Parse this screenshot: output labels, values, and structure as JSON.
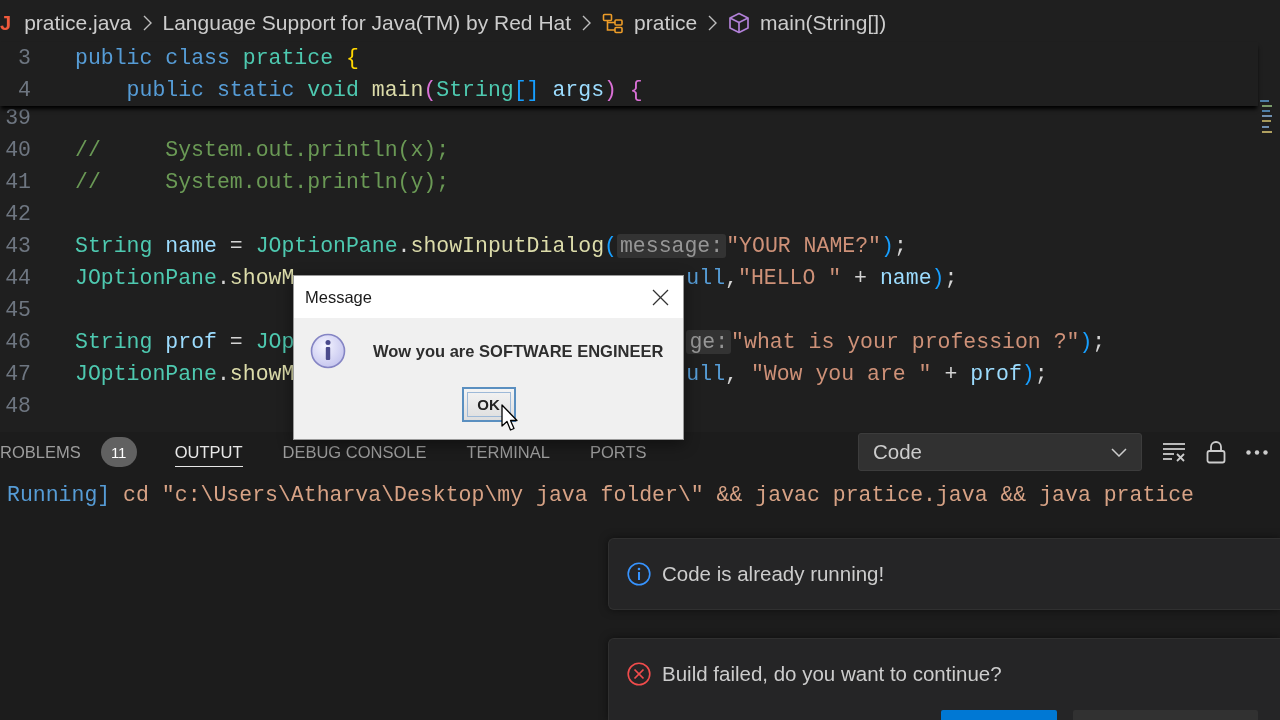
{
  "editor": {
    "breadcrumb": {
      "items": [
        {
          "label": "pratice.java",
          "kind": "file",
          "icon": "J"
        },
        {
          "label": "Language Support for Java(TM) by Red Hat",
          "kind": "module"
        },
        {
          "label": "pratice",
          "kind": "class"
        },
        {
          "label": "main(String[])",
          "kind": "method"
        }
      ]
    },
    "sticky_lines": [
      {
        "number": "3",
        "tokens": [
          {
            "text": "public",
            "kind": "keyword"
          },
          {
            "text": " class",
            "kind": "keyword"
          },
          {
            "text": " pratice",
            "kind": "type"
          },
          {
            "text": " {",
            "kind": "bracket1"
          }
        ]
      },
      {
        "number": "4",
        "tokens": [
          {
            "text": "    public",
            "kind": "keyword"
          },
          {
            "text": " static",
            "kind": "keyword"
          },
          {
            "text": " void",
            "kind": "type"
          },
          {
            "text": " main",
            "kind": "function"
          },
          {
            "text": "(",
            "kind": "bracket2"
          },
          {
            "text": "String",
            "kind": "type"
          },
          {
            "text": "[]",
            "kind": "bracket3"
          },
          {
            "text": " args",
            "kind": "variable"
          },
          {
            "text": ")",
            "kind": "bracket2"
          },
          {
            "text": " {",
            "kind": "bracket2"
          }
        ]
      }
    ],
    "lines": [
      {
        "number": "39"
      },
      {
        "number": "40",
        "tokens": [
          {
            "text": "//     System.out.println(x);",
            "kind": "comment"
          }
        ]
      },
      {
        "number": "41",
        "tokens": [
          {
            "text": "//     System.out.println(y);",
            "kind": "comment"
          }
        ]
      },
      {
        "number": "42"
      },
      {
        "number": "43",
        "tokens": [
          {
            "text": "String",
            "kind": "type"
          },
          {
            "text": " name",
            "kind": "variable"
          },
          {
            "text": " = ",
            "kind": "plain"
          },
          {
            "text": "JOptionPane",
            "kind": "type"
          },
          {
            "text": ".",
            "kind": "plain"
          },
          {
            "text": "showInputDialog",
            "kind": "function"
          },
          {
            "text": "(",
            "kind": "bracket3"
          },
          {
            "text": "message:",
            "kind": "hint"
          },
          {
            "text": "\"YOUR NAME?\"",
            "kind": "string"
          },
          {
            "text": ")",
            "kind": "bracket3"
          },
          {
            "text": ";",
            "kind": "plain"
          }
        ]
      },
      {
        "number": "44",
        "tokens": [
          {
            "text": "JOptionPane",
            "kind": "type"
          },
          {
            "text": ".",
            "kind": "plain"
          },
          {
            "text": "showM",
            "kind": "function"
          }
        ],
        "tokens_right": [
          {
            "text": "ull",
            "kind": "keyword"
          },
          {
            "text": ",",
            "kind": "plain"
          },
          {
            "text": "\"HELLO \"",
            "kind": "string"
          },
          {
            "text": " + ",
            "kind": "plain"
          },
          {
            "text": "name",
            "kind": "variable"
          },
          {
            "text": ")",
            "kind": "bracket3"
          },
          {
            "text": ";",
            "kind": "plain"
          }
        ]
      },
      {
        "number": "45"
      },
      {
        "number": "46",
        "tokens": [
          {
            "text": "String",
            "kind": "type"
          },
          {
            "text": " prof",
            "kind": "variable"
          },
          {
            "text": " = ",
            "kind": "plain"
          },
          {
            "text": "JOp",
            "kind": "type"
          }
        ],
        "tokens_right": [
          {
            "text": "ge:",
            "kind": "hint"
          },
          {
            "text": "\"what is your profession ?\"",
            "kind": "string"
          },
          {
            "text": ")",
            "kind": "bracket3"
          },
          {
            "text": ";",
            "kind": "plain"
          }
        ]
      },
      {
        "number": "47",
        "tokens": [
          {
            "text": "JOptionPane",
            "kind": "type"
          },
          {
            "text": ".",
            "kind": "plain"
          },
          {
            "text": "showM",
            "kind": "function"
          }
        ],
        "tokens_right": [
          {
            "text": "ull",
            "kind": "keyword"
          },
          {
            "text": ", ",
            "kind": "plain"
          },
          {
            "text": "\"Wow you are \"",
            "kind": "string"
          },
          {
            "text": " + ",
            "kind": "plain"
          },
          {
            "text": "prof",
            "kind": "variable"
          },
          {
            "text": ")",
            "kind": "bracket3"
          },
          {
            "text": ";",
            "kind": "plain"
          }
        ]
      },
      {
        "number": "48"
      }
    ]
  },
  "dialog": {
    "title": "Message",
    "message": "Wow you are SOFTWARE ENGINEER",
    "button": {
      "label": "OK",
      "focused": true
    }
  },
  "panel": {
    "tabs": [
      {
        "label": "ROBLEMS",
        "badge": "11",
        "selected": false
      },
      {
        "label": "OUTPUT",
        "selected": true
      },
      {
        "label": "DEBUG CONSOLE",
        "selected": false
      },
      {
        "label": "TERMINAL",
        "selected": false
      },
      {
        "label": "PORTS",
        "selected": false
      }
    ],
    "channel": "Code",
    "output": [
      {
        "segments": [
          {
            "text": "Running]",
            "kind": "status"
          },
          {
            "text": " cd \"c:\\Users\\Atharva\\Desktop\\my java folder\\\" && javac pratice.java && java pratice",
            "kind": "command"
          }
        ]
      }
    ]
  },
  "notifications": [
    {
      "kind": "info",
      "message": "Code is already running!"
    },
    {
      "kind": "error",
      "message": "Build failed, do you want to continue?",
      "actions": [
        {
          "kind": "primary"
        },
        {
          "kind": "secondary"
        }
      ]
    }
  ]
}
